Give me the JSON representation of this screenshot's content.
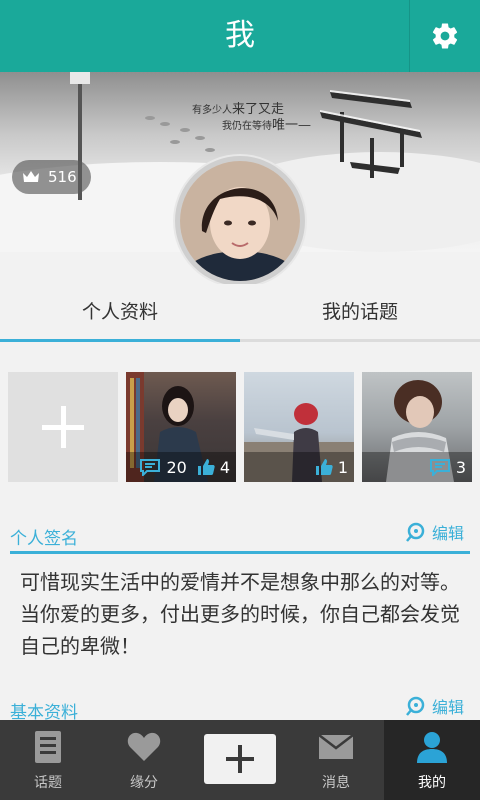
{
  "header": {
    "title": "我"
  },
  "banner": {
    "rank_count": "516",
    "line1a": "有多少人",
    "line1b": "来了又走",
    "line2a": "我仍在等待",
    "line2b": "唯一"
  },
  "tabs": [
    {
      "label": "个人资料"
    },
    {
      "label": "我的话题"
    }
  ],
  "photos": [
    {
      "comments": "20",
      "likes": "4"
    },
    {
      "likes": "1"
    },
    {
      "comments": "3"
    }
  ],
  "signature_section": {
    "label": "个人签名",
    "edit_label": "编辑",
    "text": "可惜现实生活中的爱情并不是想象中那么的对等。当你爱的更多，付出更多的时候，你自己都会发觉自己的卑微！"
  },
  "basic_section": {
    "label": "基本资料",
    "edit_label": "编辑"
  },
  "bottom_nav": [
    {
      "label": "话题",
      "icon": "topic-list-icon"
    },
    {
      "label": "缘分",
      "icon": "heart-icon"
    },
    {
      "label": "",
      "icon": "plus-icon"
    },
    {
      "label": "消息",
      "icon": "envelope-icon"
    },
    {
      "label": "我的",
      "icon": "person-icon"
    }
  ],
  "colors": {
    "header": "#1aa99a",
    "accent": "#3bb0d8",
    "nav_bg": "#3a3a3a",
    "nav_active_bg": "#262626"
  }
}
